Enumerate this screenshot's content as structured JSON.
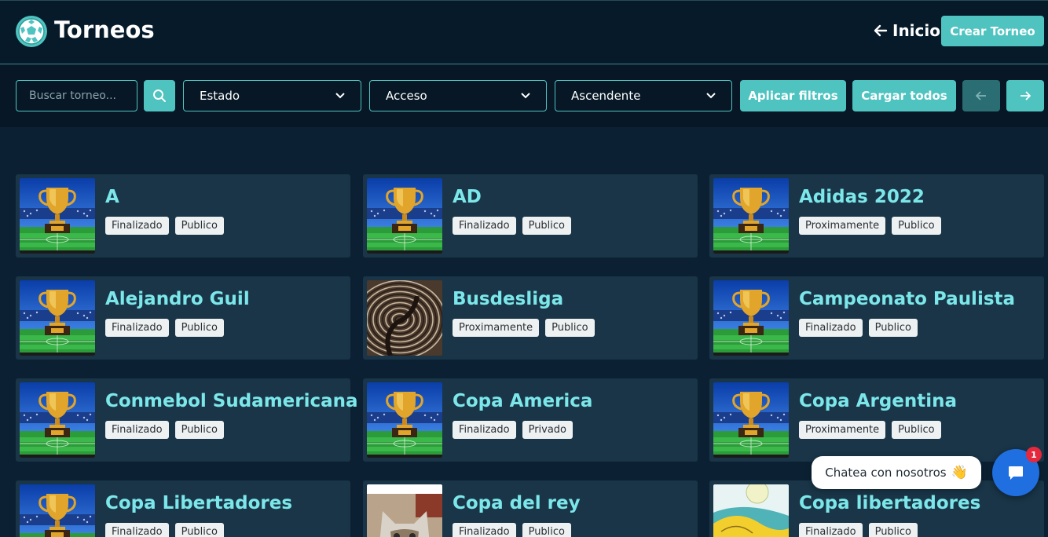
{
  "header": {
    "title": "Torneos",
    "logo_icon": "soccer-ball-icon",
    "home_label": "Inicio",
    "create_label": "Crear Torneo"
  },
  "filters": {
    "search_placeholder": "Buscar torneo...",
    "estado": "Estado",
    "acceso": "Acceso",
    "orden": "Ascendente",
    "apply_label": "Aplicar filtros",
    "load_all_label": "Cargar todos",
    "prev_icon": "arrow-left-icon",
    "next_icon": "arrow-right-icon"
  },
  "tournaments": [
    {
      "name": "A",
      "status": "Finalizado",
      "access": "Publico",
      "image": "trophy"
    },
    {
      "name": "AD",
      "status": "Finalizado",
      "access": "Publico",
      "image": "trophy"
    },
    {
      "name": "Adidas 2022",
      "status": "Proximamente",
      "access": "Publico",
      "image": "trophy"
    },
    {
      "name": "Alejandro Guil",
      "status": "Finalizado",
      "access": "Publico",
      "image": "trophy"
    },
    {
      "name": "Busdesliga",
      "status": "Proximamente",
      "access": "Publico",
      "image": "abstract"
    },
    {
      "name": "Campeonato Paulista",
      "status": "Finalizado",
      "access": "Publico",
      "image": "trophy"
    },
    {
      "name": "Conmebol Sudamericana",
      "status": "Finalizado",
      "access": "Publico",
      "image": "trophy"
    },
    {
      "name": "Copa America",
      "status": "Finalizado",
      "access": "Privado",
      "image": "trophy"
    },
    {
      "name": "Copa Argentina",
      "status": "Proximamente",
      "access": "Publico",
      "image": "trophy"
    },
    {
      "name": "Copa Libertadores",
      "status": "Finalizado",
      "access": "Publico",
      "image": "trophy"
    },
    {
      "name": "Copa del rey",
      "status": "Finalizado",
      "access": "Publico",
      "image": "kitten"
    },
    {
      "name": "Copa libertadores",
      "status": "Finalizado",
      "access": "Publico",
      "image": "sketch"
    }
  ],
  "chat": {
    "bubble_text": "Chatea con nosotros",
    "badge_count": "1",
    "emoji_icon": "waving-hand-icon",
    "chat_icon": "chat-icon"
  },
  "colors": {
    "accent": "#4ec3c0",
    "title_color": "#7ce7ea",
    "card_bg": "#193547",
    "page_bg": "#0b2133"
  }
}
